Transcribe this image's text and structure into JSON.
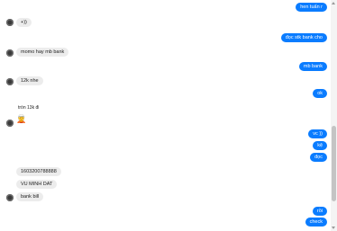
{
  "messages": {
    "m1": "hen tuấn r",
    "m2": "+))",
    "m3": "đọc stk bank cho",
    "m4": "momo hay mb bank",
    "m5": "mb bank",
    "m6": "12k nhe",
    "m7": "ok",
    "m8": "tròn 13k đi",
    "m9": "🧝",
    "m10": "vc ))",
    "m11": "kệ",
    "m12": "đọc",
    "m13": "1603200788888",
    "m14": "VU MINH DAT",
    "m15": "bank bill",
    "m16": "rồi",
    "m17": "check"
  }
}
